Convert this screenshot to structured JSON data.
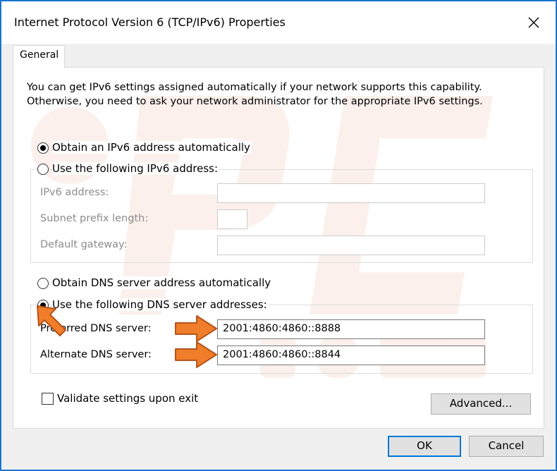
{
  "window": {
    "title": "Internet Protocol Version 6 (TCP/IPv6) Properties",
    "close_glyph": "✕"
  },
  "tabs": [
    {
      "label": "General"
    }
  ],
  "intro": {
    "line1": "You can get IPv6 settings assigned automatically if your network supports this capability.",
    "line2": "Otherwise, you need to ask your network administrator for the appropriate IPv6 settings."
  },
  "address": {
    "auto_label": "Obtain an IPv6 address automatically",
    "auto_selected": true,
    "manual_label": "Use the following IPv6 address:",
    "manual_selected": false,
    "fields": {
      "ipv6_label": "IPv6 address:",
      "ipv6_value": "",
      "prefix_label": "Subnet prefix length:",
      "prefix_value": "",
      "gateway_label": "Default gateway:",
      "gateway_value": ""
    }
  },
  "dns": {
    "auto_label": "Obtain DNS server address automatically",
    "auto_selected": false,
    "manual_label": "Use the following DNS server addresses:",
    "manual_selected": true,
    "preferred_label": "Preferred DNS server:",
    "preferred_value": "2001:4860:4860::8888",
    "alternate_label": "Alternate DNS server:",
    "alternate_value": "2001:4860:4860::8844"
  },
  "validate": {
    "label": "Validate settings upon exit",
    "checked": false
  },
  "buttons": {
    "advanced": "Advanced...",
    "ok": "OK",
    "cancel": "Cancel"
  },
  "annotation": {
    "arrow_color": "#f07d2a",
    "arrow_outline": "#b5541b"
  },
  "watermark": {
    "color": "#f3c9b8"
  },
  "icons": [
    "close-icon",
    "arrow-pointer-icon"
  ]
}
